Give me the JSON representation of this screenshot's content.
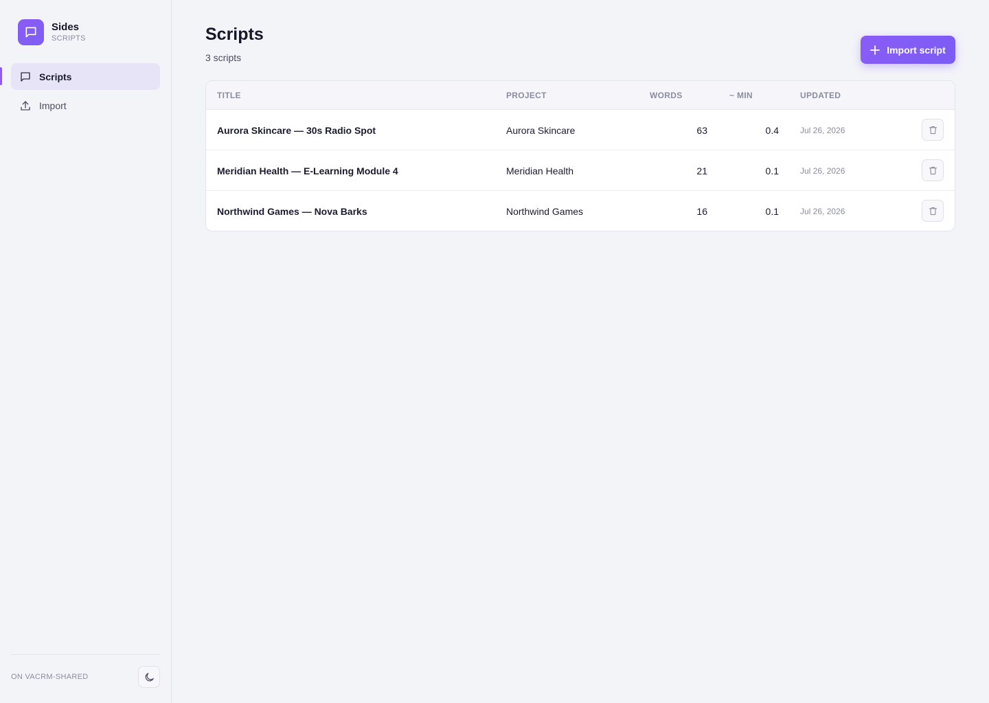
{
  "brand": {
    "name": "Sides",
    "subtitle": "SCRIPTS"
  },
  "sidebar": {
    "items": [
      {
        "label": "Scripts",
        "icon": "chat-bubble-icon",
        "active": true
      },
      {
        "label": "Import",
        "icon": "upload-icon",
        "active": false
      }
    ],
    "env_label": "ON VACRM-SHARED"
  },
  "header": {
    "title": "Scripts",
    "count": "3 scripts",
    "import_label": "Import script"
  },
  "table": {
    "columns": {
      "title": "TITLE",
      "project": "PROJECT",
      "words": "WORDS",
      "min": "~ MIN",
      "updated": "UPDATED"
    },
    "rows": [
      {
        "title": "Aurora Skincare — 30s Radio Spot",
        "project": "Aurora Skincare",
        "words": "63",
        "min": "0.4",
        "updated": "Jul 26, 2026"
      },
      {
        "title": "Meridian Health — E-Learning Module 4",
        "project": "Meridian Health",
        "words": "21",
        "min": "0.1",
        "updated": "Jul 26, 2026"
      },
      {
        "title": "Northwind Games — Nova Barks",
        "project": "Northwind Games",
        "words": "16",
        "min": "0.1",
        "updated": "Jul 26, 2026"
      }
    ]
  },
  "colors": {
    "accent": "#8b5cf6",
    "background": "#f3f4f8",
    "text": "#1a1b2e",
    "muted": "#8a8ca0"
  }
}
